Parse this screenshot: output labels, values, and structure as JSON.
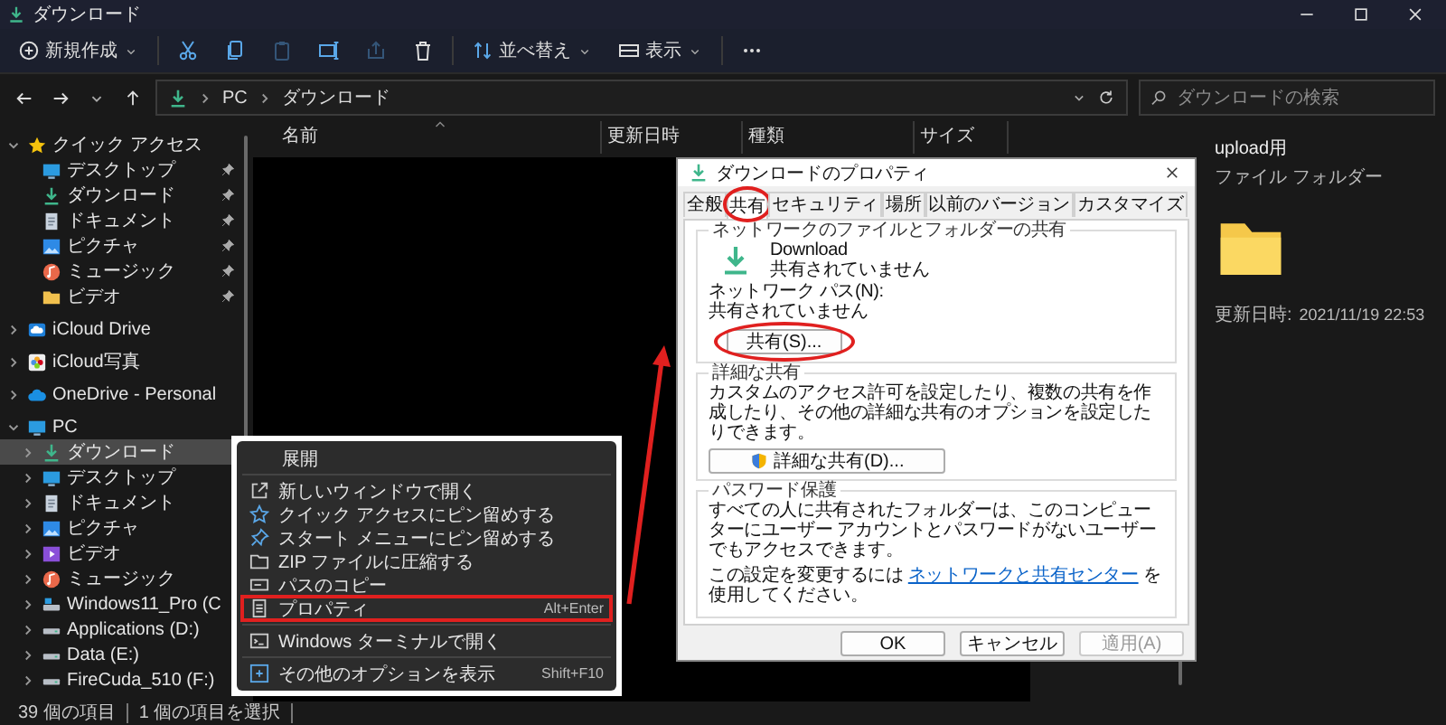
{
  "window": {
    "title": "ダウンロード"
  },
  "toolbar": {
    "items": [
      {
        "kind": "new",
        "label": "新規作成",
        "disabled": false
      },
      {
        "kind": "cut",
        "disabled": false
      },
      {
        "kind": "copy",
        "disabled": false
      },
      {
        "kind": "paste",
        "disabled": true
      },
      {
        "kind": "rename",
        "disabled": false
      },
      {
        "kind": "share",
        "disabled": true
      },
      {
        "kind": "delete",
        "disabled": false
      },
      {
        "kind": "sort",
        "label": "並べ替え",
        "disabled": false
      },
      {
        "kind": "view",
        "label": "表示",
        "disabled": false
      },
      {
        "kind": "more",
        "disabled": false
      }
    ]
  },
  "address": {
    "path": [
      "PC",
      "ダウンロード"
    ]
  },
  "search": {
    "placeholder": "ダウンロードの検索"
  },
  "sidebar": {
    "items": [
      {
        "label": "クイック アクセス",
        "kind": "star",
        "expanded": true,
        "selected": false,
        "children": [
          {
            "label": "デスクトップ",
            "kind": "desktop",
            "pinned": true,
            "selected": false
          },
          {
            "label": "ダウンロード",
            "kind": "download",
            "pinned": true,
            "selected": false
          },
          {
            "label": "ドキュメント",
            "kind": "document",
            "pinned": true,
            "selected": false
          },
          {
            "label": "ピクチャ",
            "kind": "picture",
            "pinned": true,
            "selected": false
          },
          {
            "label": "ミュージック",
            "kind": "music",
            "pinned": true,
            "selected": false
          },
          {
            "label": "ビデオ",
            "kind": "folder",
            "pinned": true,
            "selected": false
          }
        ]
      },
      {
        "label": "iCloud Drive",
        "kind": "icloud",
        "expanded": false,
        "selected": false
      },
      {
        "label": "iCloud写真",
        "kind": "photos",
        "expanded": false,
        "selected": false
      },
      {
        "label": "OneDrive - Personal",
        "kind": "onedrive",
        "expanded": false,
        "selected": false
      },
      {
        "label": "PC",
        "kind": "pc",
        "expanded": true,
        "selected": false,
        "children": [
          {
            "label": "ダウンロード",
            "kind": "download",
            "expanded": false,
            "selected": true
          },
          {
            "label": "デスクトップ",
            "kind": "desktop",
            "expanded": false,
            "selected": false
          },
          {
            "label": "ドキュメント",
            "kind": "document",
            "expanded": false,
            "selected": false
          },
          {
            "label": "ピクチャ",
            "kind": "picture",
            "expanded": false,
            "selected": false
          },
          {
            "label": "ビデオ",
            "kind": "video",
            "expanded": false,
            "selected": false
          },
          {
            "label": "ミュージック",
            "kind": "music",
            "expanded": false,
            "selected": false
          },
          {
            "label": "Windows11_Pro (C",
            "kind": "osdrive",
            "expanded": false,
            "selected": false
          },
          {
            "label": "Applications (D:)",
            "kind": "drive",
            "expanded": false,
            "selected": false
          },
          {
            "label": "Data (E:)",
            "kind": "drive",
            "expanded": false,
            "selected": false
          },
          {
            "label": "FireCuda_510 (F:)",
            "kind": "drive",
            "expanded": false,
            "selected": false
          }
        ]
      }
    ]
  },
  "table": {
    "columns": [
      "名前",
      "更新日時",
      "種類",
      "サイズ"
    ]
  },
  "details": {
    "name": "upload用",
    "type": "ファイル フォルダー",
    "modified_label": "更新日時:",
    "modified": "2021/11/19 22:53"
  },
  "status_bar": {
    "item_count": "39 個の項目",
    "selection": "1 個の項目を選択"
  },
  "context_menu": {
    "groups": [
      [
        {
          "kind": "header",
          "label": "展開",
          "highlighted": false
        }
      ],
      [
        {
          "kind": "open-window",
          "label": "新しいウィンドウで開く",
          "highlighted": false
        },
        {
          "kind": "pin-quick",
          "label": "クイック アクセスにピン留めする",
          "highlighted": false
        },
        {
          "kind": "pin-start",
          "label": "スタート メニューにピン留めする",
          "highlighted": false
        },
        {
          "kind": "zip",
          "label": "ZIP ファイルに圧縮する",
          "highlighted": false
        },
        {
          "kind": "copy-path",
          "label": "パスのコピー",
          "highlighted": false
        },
        {
          "kind": "properties",
          "label": "プロパティ",
          "shortcut": "Alt+Enter",
          "highlighted": true
        }
      ],
      [
        {
          "kind": "terminal",
          "label": "Windows ターミナルで開く",
          "highlighted": false
        }
      ],
      [
        {
          "kind": "more-options",
          "label": "その他のオプションを表示",
          "shortcut": "Shift+F10",
          "highlighted": false
        }
      ]
    ]
  },
  "dialog": {
    "title": "ダウンロードのプロパティ",
    "tabs": [
      {
        "label": "全般",
        "selected": false,
        "highlighted": false
      },
      {
        "label": "共有",
        "selected": true,
        "highlighted": true
      },
      {
        "label": "セキュリティ",
        "selected": false,
        "highlighted": false
      },
      {
        "label": "場所",
        "selected": false,
        "highlighted": false
      },
      {
        "label": "以前のバージョン",
        "selected": false,
        "highlighted": false
      },
      {
        "label": "カスタマイズ",
        "selected": false,
        "highlighted": false
      }
    ],
    "network_sharing": {
      "legend": "ネットワークのファイルとフォルダーの共有",
      "folder_name": "Download",
      "folder_status": "共有されていません",
      "path_label": "ネットワーク パス(N):",
      "path_value": "共有されていません",
      "button": {
        "label": "共有(S)...",
        "highlighted": true
      }
    },
    "advanced_sharing": {
      "legend": "詳細な共有",
      "description": "カスタムのアクセス許可を設定したり、複数の共有を作成したり、その他の詳細な共有のオプションを設定したりできます。",
      "button": {
        "label": "詳細な共有(D)..."
      }
    },
    "password_protection": {
      "legend": "パスワード保護",
      "description": "すべての人に共有されたフォルダーは、このコンピューターにユーザー アカウントとパスワードがないユーザーでもアクセスできます。",
      "change_before": "この設定を変更するには",
      "link": "ネットワークと共有センター",
      "change_after": "を使用してください。"
    },
    "buttons": [
      {
        "label": "OK",
        "disabled": false
      },
      {
        "label": "キャンセル",
        "disabled": false
      },
      {
        "label": "適用(A)",
        "disabled": true
      }
    ]
  }
}
